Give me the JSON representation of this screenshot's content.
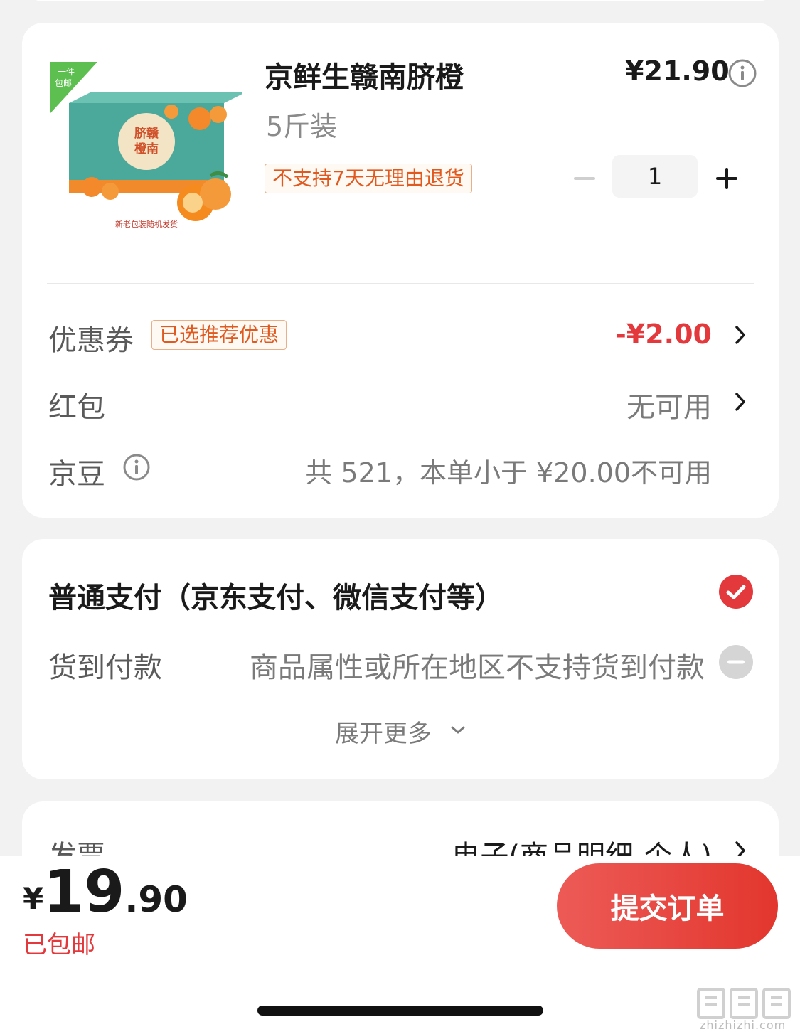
{
  "product": {
    "image_badge": "一件\n包邮",
    "image_caption": "新老包装随机发货",
    "image_box_text": "脐赣\n橙南",
    "title": "京鲜生赣南脐橙",
    "spec": "5斤装",
    "tag": "不支持7天无理由退货",
    "price": "¥21.90",
    "quantity": "1"
  },
  "discounts": {
    "coupon_label": "优惠券",
    "coupon_tag": "已选推荐优惠",
    "coupon_value": "-¥2.00",
    "redpack_label": "红包",
    "redpack_value": "无可用",
    "jd_bean_label": "京豆",
    "jd_bean_value": "共 521，本单小于 ¥20.00不可用"
  },
  "payment": {
    "normal_label": "普通支付（京东支付、微信支付等）",
    "cod_label": "货到付款",
    "cod_desc": "商品属性或所在地区不支持货到付款",
    "expand_more": "展开更多"
  },
  "invoice": {
    "label": "发票",
    "value": "电子(商品明细-个人)"
  },
  "bottom_bar": {
    "yen": "¥",
    "price_int": "19",
    "price_dec": ".90",
    "shipping_note": "已包邮",
    "submit_label": "提交订单"
  },
  "watermark": {
    "site": "zhizhizhi.com"
  },
  "colors": {
    "accent_red": "#e4393c",
    "tag_orange": "#e05a1f",
    "button_gradient_start": "#ed5b57",
    "button_gradient_end": "#e2362d"
  },
  "icons": [
    "info-icon",
    "minus-icon",
    "plus-icon",
    "chevron-right-icon",
    "check-circle-icon",
    "disabled-circle-icon",
    "chevron-down-icon"
  ]
}
